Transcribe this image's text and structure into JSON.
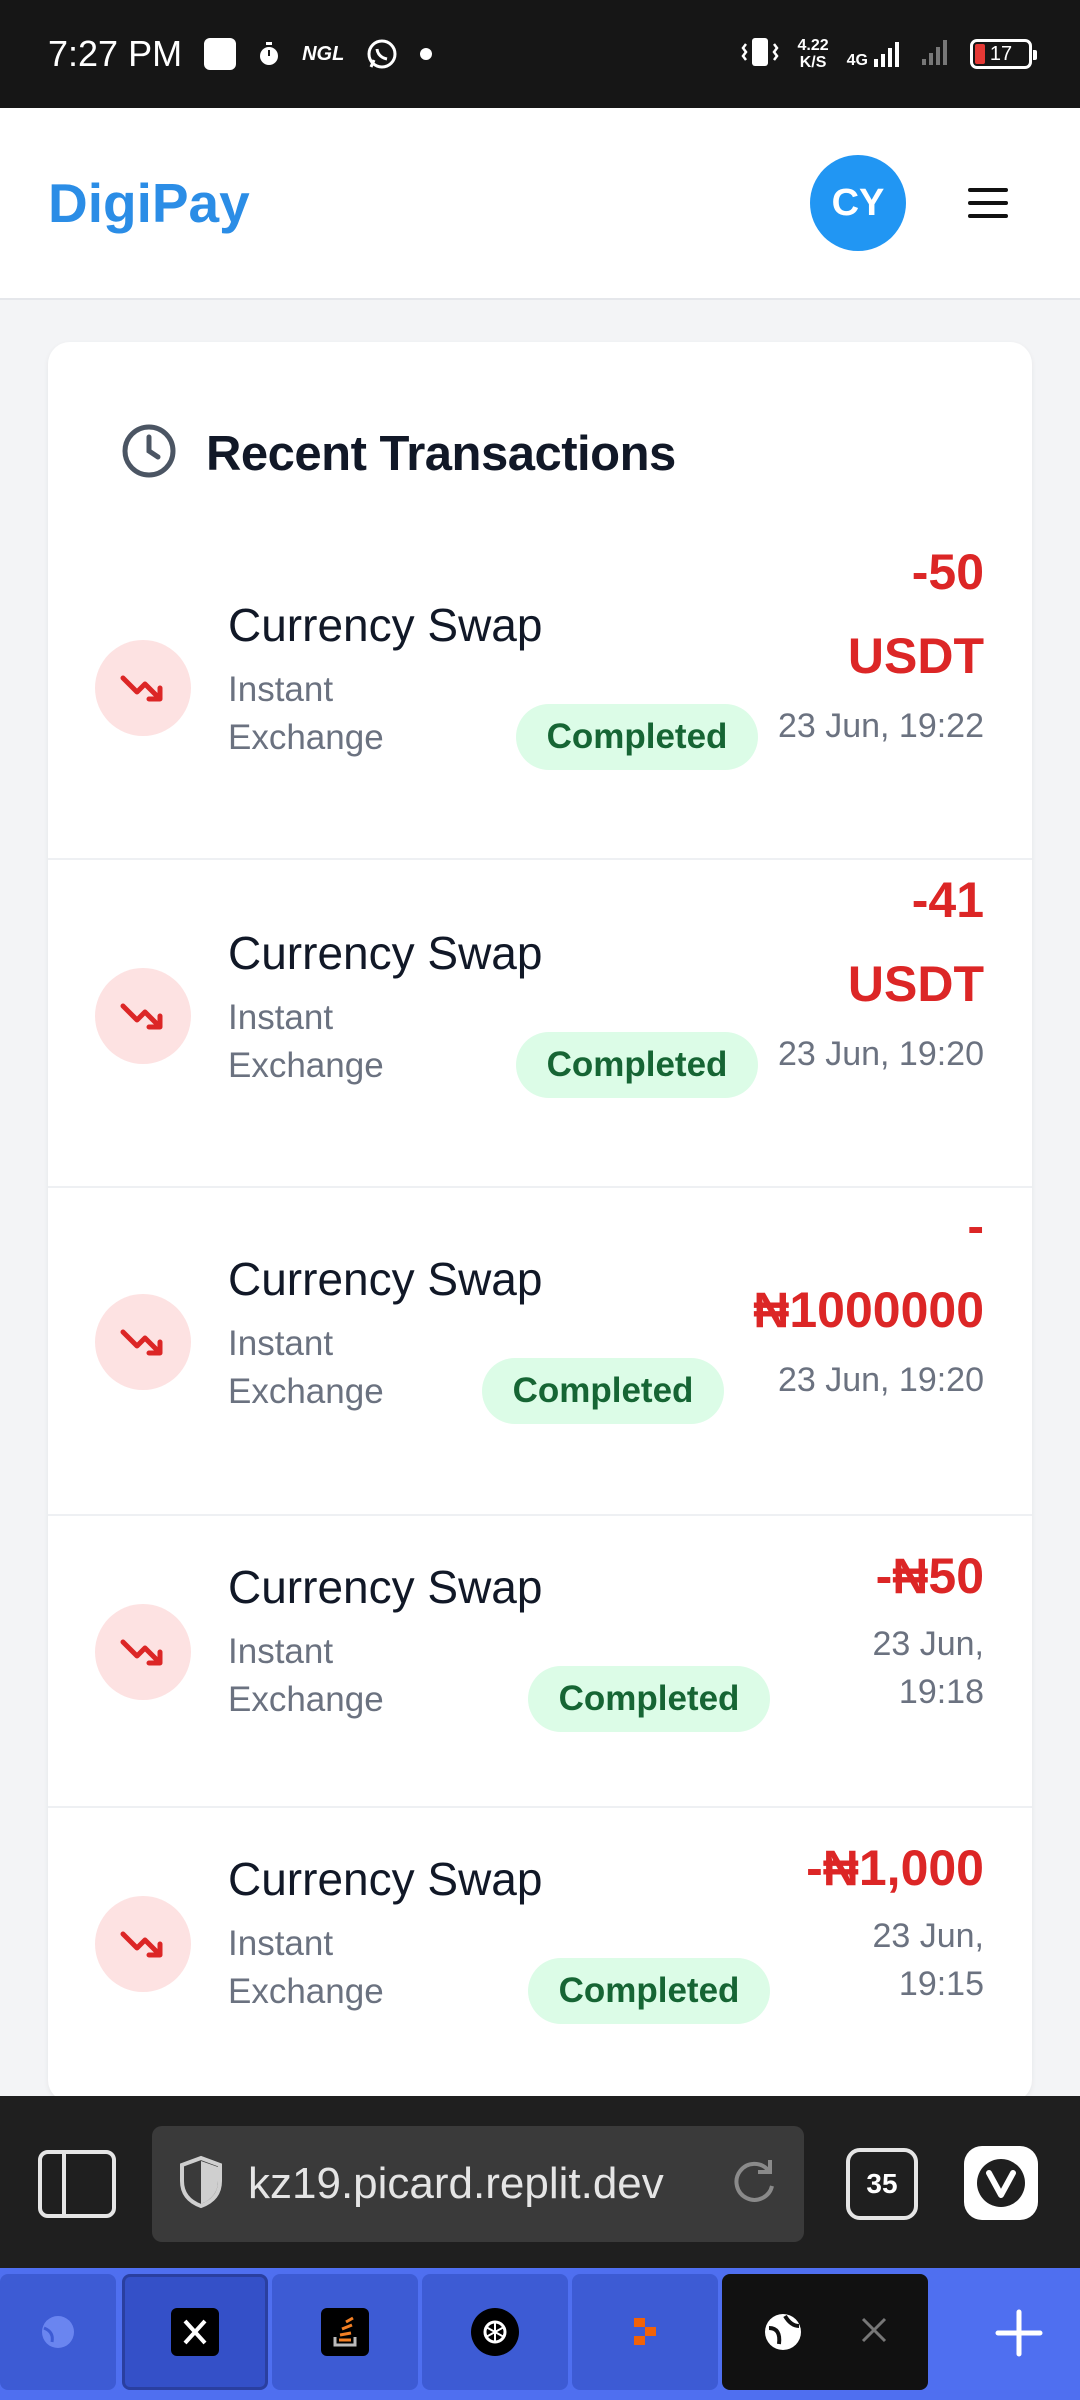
{
  "status_bar": {
    "time": "7:27 PM",
    "notif_icons": [
      "square-app-icon",
      "timer-icon",
      "ngl-icon",
      "whatsapp-icon",
      "dot-icon"
    ],
    "ngl_label": "NGL",
    "net_speed_value": "4.22",
    "net_speed_unit": "K/S",
    "network": "4G",
    "battery": "17"
  },
  "app": {
    "brand": "DigiPay",
    "avatar_initials": "CY",
    "brand_color": "#2b8de6"
  },
  "recent": {
    "title": "Recent Transactions",
    "transactions": [
      {
        "name": "Currency Swap",
        "sub": "Instant Exchange",
        "status": "Completed",
        "amount_line1": "-50",
        "amount_line2": "USDT",
        "date_line1": "23 Jun, 19:22",
        "date_line2": ""
      },
      {
        "name": "Currency Swap",
        "sub": "Instant Exchange",
        "status": "Completed",
        "amount_line1": "-41",
        "amount_line2": "USDT",
        "date_line1": "23 Jun, 19:20",
        "date_line2": ""
      },
      {
        "name": "Currency Swap",
        "sub": "Instant Exchange",
        "status": "Completed",
        "amount_line1": "-",
        "amount_line2": "₦1000000",
        "date_line1": "23 Jun, 19:20",
        "date_line2": ""
      },
      {
        "name": "Currency Swap",
        "sub": "Instant Exchange",
        "status": "Completed",
        "amount_line1": "-₦50",
        "amount_line2": "",
        "date_line1": "23 Jun,",
        "date_line2": "19:18"
      },
      {
        "name": "Currency Swap",
        "sub": "Instant Exchange",
        "status": "Completed",
        "amount_line1": "-₦1,000",
        "amount_line2": "",
        "date_line1": "23 Jun,",
        "date_line2": "19:15"
      }
    ],
    "debit_color": "#dc2626",
    "status_color": "#166534"
  },
  "browser": {
    "url": "kz19.picard.replit.dev",
    "tab_count": "35",
    "tabs": [
      "globe-tab",
      "x-tab",
      "stackoverflow-tab",
      "chatgpt-tab",
      "replit-tab",
      "current-globe-tab"
    ]
  }
}
